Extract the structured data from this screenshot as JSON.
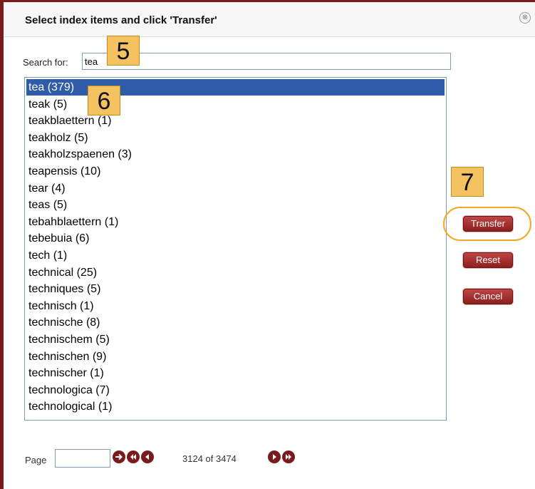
{
  "dialog": {
    "title": "Select index items and click 'Transfer'",
    "close_icon": "close-icon",
    "close_glyph": "⊗"
  },
  "search": {
    "label": "Search for:",
    "value": "tea"
  },
  "list": {
    "items": [
      "tea (379)",
      "teak (5)",
      "teakblaettern (1)",
      "teakholz (5)",
      "teakholzspaenen (3)",
      "teapensis (10)",
      "tear (4)",
      "teas (5)",
      "tebahblaettern (1)",
      "tebebuia (6)",
      "tech (1)",
      "technical (25)",
      "techniques (5)",
      "technisch (1)",
      "technische (8)",
      "technischem (5)",
      "technischen (9)",
      "technischer (1)",
      "technologica (7)",
      "technological (1)"
    ],
    "selected_index": 0
  },
  "buttons": {
    "transfer": "Transfer",
    "reset": "Reset",
    "cancel": "Cancel"
  },
  "annotations": {
    "step5": "5",
    "step6": "6",
    "step7": "7",
    "highlight_color": "#f5a623",
    "badge_color": "#f5c261"
  },
  "pagination": {
    "label": "Page",
    "value": "",
    "status": "3124 of 3474",
    "icons": [
      "go-arrow-icon",
      "first-page-icon",
      "prev-page-icon",
      "next-page-icon",
      "last-page-icon"
    ]
  },
  "colors": {
    "frame_border": "#7a1a1a",
    "selection": "#2e5ca9",
    "button": "#a83232"
  }
}
